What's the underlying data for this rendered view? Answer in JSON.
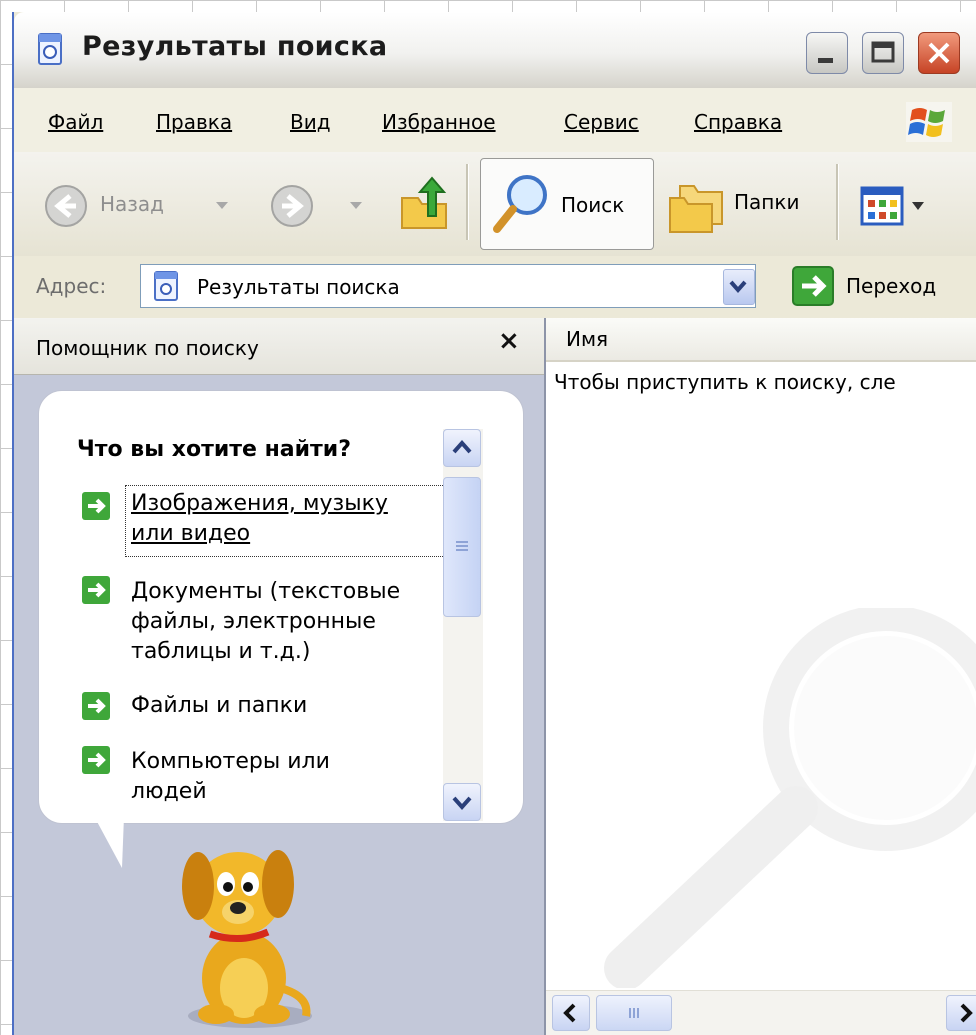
{
  "window": {
    "title": "Результаты поиска"
  },
  "menu": {
    "items": [
      "Файл",
      "Правка",
      "Вид",
      "Избранное",
      "Сервис",
      "Справка"
    ]
  },
  "toolbar": {
    "back_label": "Назад",
    "search_label": "Поиск",
    "folders_label": "Папки"
  },
  "address": {
    "label": "Адрес:",
    "value": "Результаты поиска",
    "go_label": "Переход"
  },
  "search_pane": {
    "title": "Помощник по поиску",
    "close_glyph": "×",
    "question": "Что вы хотите найти?",
    "options": [
      {
        "label_line1": "Изображения, музыку",
        "label_line2": "или видео",
        "label_line3": ""
      },
      {
        "label_line1": "Документы (текстовые",
        "label_line2": "файлы, электронные",
        "label_line3": "таблицы и т.д.)"
      },
      {
        "label_line1": "Файлы и папки",
        "label_line2": "",
        "label_line3": ""
      },
      {
        "label_line1": "Компьютеры или",
        "label_line2": "людей",
        "label_line3": ""
      }
    ]
  },
  "results": {
    "column_name": "Имя",
    "hint": "Чтобы приступить к поиску, сле"
  },
  "colors": {
    "titlebar_accent": "#4d6fc4",
    "left_pane_bg": "#c3c8d9",
    "go_green": "#3fa73a",
    "close_red": "#c64325"
  }
}
